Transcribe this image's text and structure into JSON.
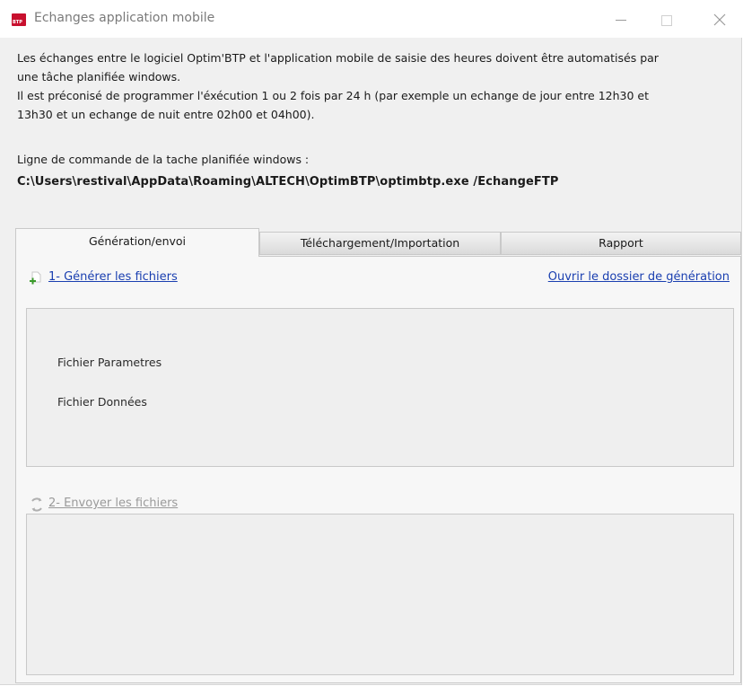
{
  "window": {
    "title": "Echanges application mobile",
    "icon_text": "BTP",
    "icon_color": "#c8102e",
    "minimize_symbol": "—",
    "close_symbol": "✕"
  },
  "description": {
    "line1": "Les échanges entre le logiciel Optim'BTP et l'application mobile de saisie des heures doivent être automatisés par",
    "line2": "une tâche planifiée windows.",
    "line3": "Il est préconisé de programmer l'éxécution 1 ou 2 fois par 24 h (par exemple un echange de jour entre 12h30 et",
    "line4": "13h30 et un echange de nuit entre 02h00 et 04h00).",
    "command_label": "Ligne de commande de la tache planifiée windows :",
    "command_line": "C:\\Users\\restival\\AppData\\Roaming\\ALTECH\\OptimBTP\\optimbtp.exe /EchangeFTP"
  },
  "tabs": [
    {
      "label": "Génération/envoi",
      "active": true
    },
    {
      "label": "Téléchargement/Importation",
      "active": false
    },
    {
      "label": "Rapport",
      "active": false
    }
  ],
  "generation": {
    "generate_link": "1- Générer les fichiers",
    "open_folder_link": "Ouvrir le dossier de génération",
    "files": {
      "params": "Fichier Parametres",
      "data": "Fichier Données"
    },
    "send_link": "2- Envoyer les fichiers"
  },
  "colors": {
    "link": "#1a3fb0",
    "disabled_link": "#9a9a9a",
    "background": "#f0f0f0"
  }
}
